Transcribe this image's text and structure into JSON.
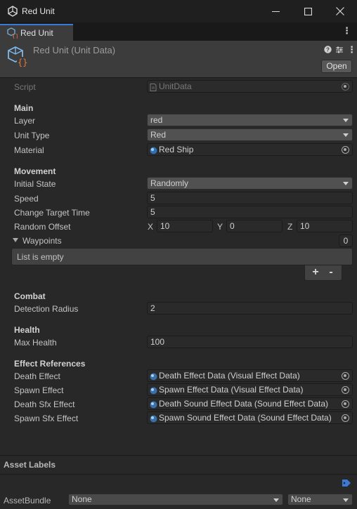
{
  "window": {
    "title": "Red Unit"
  },
  "tab": {
    "label": "Red Unit"
  },
  "header": {
    "title": "Red Unit (Unit Data)",
    "open_label": "Open"
  },
  "script": {
    "label": "Script",
    "value": "UnitData"
  },
  "main": {
    "section": "Main",
    "layer": {
      "label": "Layer",
      "value": "red"
    },
    "unit_type": {
      "label": "Unit Type",
      "value": "Red"
    },
    "material": {
      "label": "Material",
      "value": "Red Ship"
    }
  },
  "movement": {
    "section": "Movement",
    "initial_state": {
      "label": "Initial State",
      "value": "Randomly"
    },
    "speed": {
      "label": "Speed",
      "value": "5"
    },
    "change_target_time": {
      "label": "Change Target Time",
      "value": "5"
    },
    "random_offset": {
      "label": "Random Offset",
      "x_label": "X",
      "x": "10",
      "y_label": "Y",
      "y": "0",
      "z_label": "Z",
      "z": "10"
    },
    "waypoints": {
      "label": "Waypoints",
      "count": "0",
      "empty_text": "List is empty",
      "add": "+",
      "remove": "-"
    }
  },
  "combat": {
    "section": "Combat",
    "detection_radius": {
      "label": "Detection Radius",
      "value": "2"
    }
  },
  "health": {
    "section": "Health",
    "max_health": {
      "label": "Max Health",
      "value": "100"
    }
  },
  "effects": {
    "section": "Effect References",
    "death_effect": {
      "label": "Death Effect",
      "value": "Death Effect Data (Visual Effect Data)"
    },
    "spawn_effect": {
      "label": "Spawn Effect",
      "value": "Spawn Effect Data (Visual Effect Data)"
    },
    "death_sfx": {
      "label": "Death Sfx Effect",
      "value": "Death Sound Effect Data (Sound Effect Data)"
    },
    "spawn_sfx": {
      "label": "Spawn Sfx Effect",
      "value": "Spawn Sound Effect Data (Sound Effect Data)"
    }
  },
  "assets": {
    "labels_title": "Asset Labels",
    "bundle_label": "AssetBundle",
    "bundle_value": "None",
    "variant_value": "None"
  },
  "colors": {
    "accent": "#3a7ad6",
    "background": "#282828",
    "header": "#3c3c3c"
  }
}
